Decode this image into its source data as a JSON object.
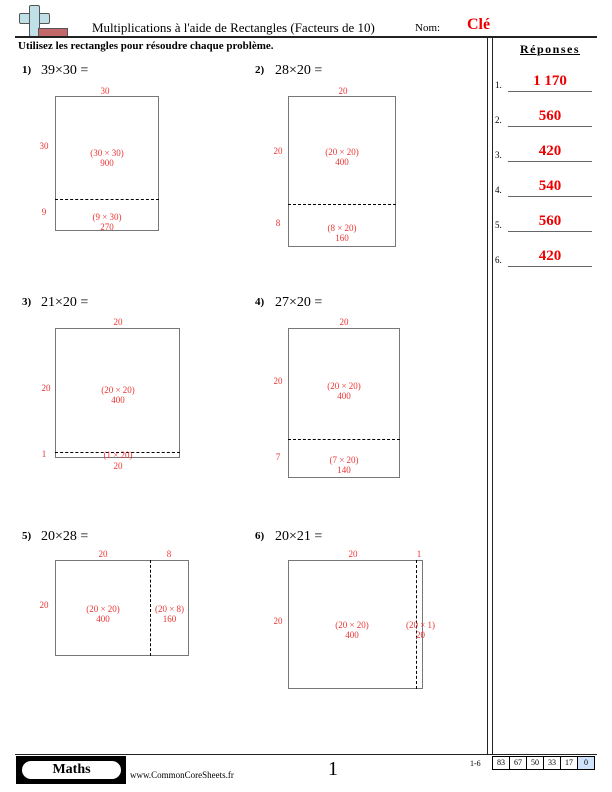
{
  "header": {
    "title": "Multiplications à l'aide de Rectangles (Facteurs de 10)",
    "name_label": "Nom:",
    "name_value": "Clé",
    "instructions": "Utilisez les rectangles pour résoudre chaque problème."
  },
  "answers": {
    "title": "Réponses",
    "items": [
      {
        "num": "1.",
        "value": "1 170"
      },
      {
        "num": "2.",
        "value": "560"
      },
      {
        "num": "3.",
        "value": "420"
      },
      {
        "num": "4.",
        "value": "540"
      },
      {
        "num": "5.",
        "value": "560"
      },
      {
        "num": "6.",
        "value": "420"
      }
    ]
  },
  "problems": [
    {
      "num": "1)",
      "expr": "39×30 =",
      "top": "30",
      "left_a": "30",
      "left_b": "9",
      "cell_a_expr": "(30 × 30)",
      "cell_a_val": "900",
      "cell_b_expr": "(9 × 30)",
      "cell_b_val": "270"
    },
    {
      "num": "2)",
      "expr": "28×20 =",
      "top": "20",
      "left_a": "20",
      "left_b": "8",
      "cell_a_expr": "(20 × 20)",
      "cell_a_val": "400",
      "cell_b_expr": "(8 × 20)",
      "cell_b_val": "160"
    },
    {
      "num": "3)",
      "expr": "21×20 =",
      "top": "20",
      "left_a": "20",
      "left_b": "1",
      "cell_a_expr": "(20 × 20)",
      "cell_a_val": "400",
      "cell_b_expr": "(1 × 20)",
      "cell_b_val": "20"
    },
    {
      "num": "4)",
      "expr": "27×20 =",
      "top": "20",
      "left_a": "20",
      "left_b": "7",
      "cell_a_expr": "(20 × 20)",
      "cell_a_val": "400",
      "cell_b_expr": "(7 × 20)",
      "cell_b_val": "140"
    },
    {
      "num": "5)",
      "expr": "20×28 =",
      "top_a": "20",
      "top_b": "8",
      "left": "20",
      "cell_a_expr": "(20 × 20)",
      "cell_a_val": "400",
      "cell_b_expr": "(20 × 8)",
      "cell_b_val": "160"
    },
    {
      "num": "6)",
      "expr": "20×21 =",
      "top_a": "20",
      "top_b": "1",
      "left": "20",
      "cell_a_expr": "(20 × 20)",
      "cell_a_val": "400",
      "cell_b_expr": "(20 × 1)",
      "cell_b_val": "20"
    }
  ],
  "footer": {
    "subject": "Maths",
    "site": "www.CommonCoreSheets.fr",
    "page": "1",
    "range": "1-6",
    "scores": [
      "83",
      "67",
      "50",
      "33",
      "17",
      "0"
    ]
  }
}
